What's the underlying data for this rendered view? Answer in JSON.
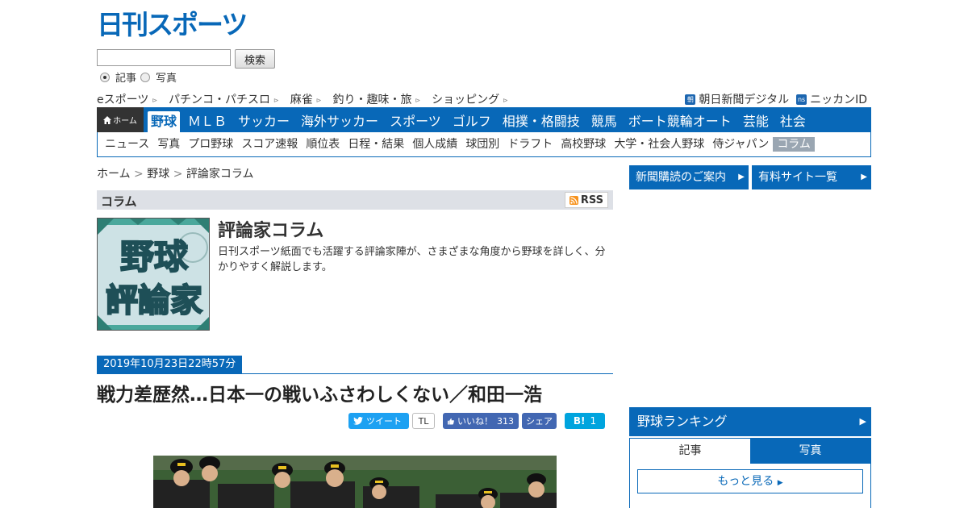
{
  "logo": {
    "text": "日刊スポーツ"
  },
  "search": {
    "value": "",
    "button_label": "検索",
    "options": [
      {
        "label": "記事",
        "checked": true
      },
      {
        "label": "写真",
        "checked": false
      }
    ]
  },
  "toplinks": {
    "left": [
      "eスポーツ",
      "パチンコ・パチスロ",
      "麻雀",
      "釣り・趣味・旅",
      "ショッピング"
    ],
    "right": [
      {
        "badge": "朝",
        "label": "朝日新聞デジタル"
      },
      {
        "badge": "ns",
        "label": "ニッカンID"
      }
    ]
  },
  "gnav": {
    "home_label": "ホーム",
    "active": "野球",
    "items": [
      "ＭＬＢ",
      "サッカー",
      "海外サッカー",
      "スポーツ",
      "ゴルフ",
      "相撲・格闘技",
      "競馬",
      "ボート競輪オート",
      "芸能",
      "社会"
    ]
  },
  "subnav": {
    "items": [
      "ニュース",
      "写真",
      "プロ野球",
      "スコア速報",
      "順位表",
      "日程・結果",
      "個人成績",
      "球団別",
      "ドラフト",
      "高校野球",
      "大学・社会人野球",
      "侍ジャパン"
    ],
    "active": "コラム"
  },
  "breadcrumb": {
    "items": [
      "ホーム",
      "野球",
      "評論家コラム"
    ],
    "sep": ">"
  },
  "column_bar": {
    "title": "コラム",
    "rss_label": "RSS"
  },
  "profile": {
    "thumb_lines": [
      "野球",
      "評論家"
    ],
    "title": "評論家コラム",
    "description": "日刊スポーツ紙面でも活躍する評論家陣が、さまざまな角度から野球を詳しく、分かりやすく解説します。"
  },
  "article": {
    "date": "2019年10月23日22時57分",
    "headline": "戦力差歴然…日本一の戦いふさわしくない／和田一浩"
  },
  "social": {
    "tweet": "ツイート",
    "tl": "TL",
    "like": "いいね！",
    "like_count": "313",
    "share": "シェア",
    "hatena": "B!",
    "hatena_count": "1"
  },
  "sidebar": {
    "buttons": [
      "新聞購読のご案内",
      "有料サイト一覧"
    ],
    "ranking_title": "野球ランキング",
    "ranking_tabs": [
      "記事",
      "写真"
    ],
    "more_label": "もっと見る"
  },
  "colors": {
    "brand": "#0868b8",
    "nav_dark": "#333333",
    "subnav_active": "#9aa6b2"
  }
}
